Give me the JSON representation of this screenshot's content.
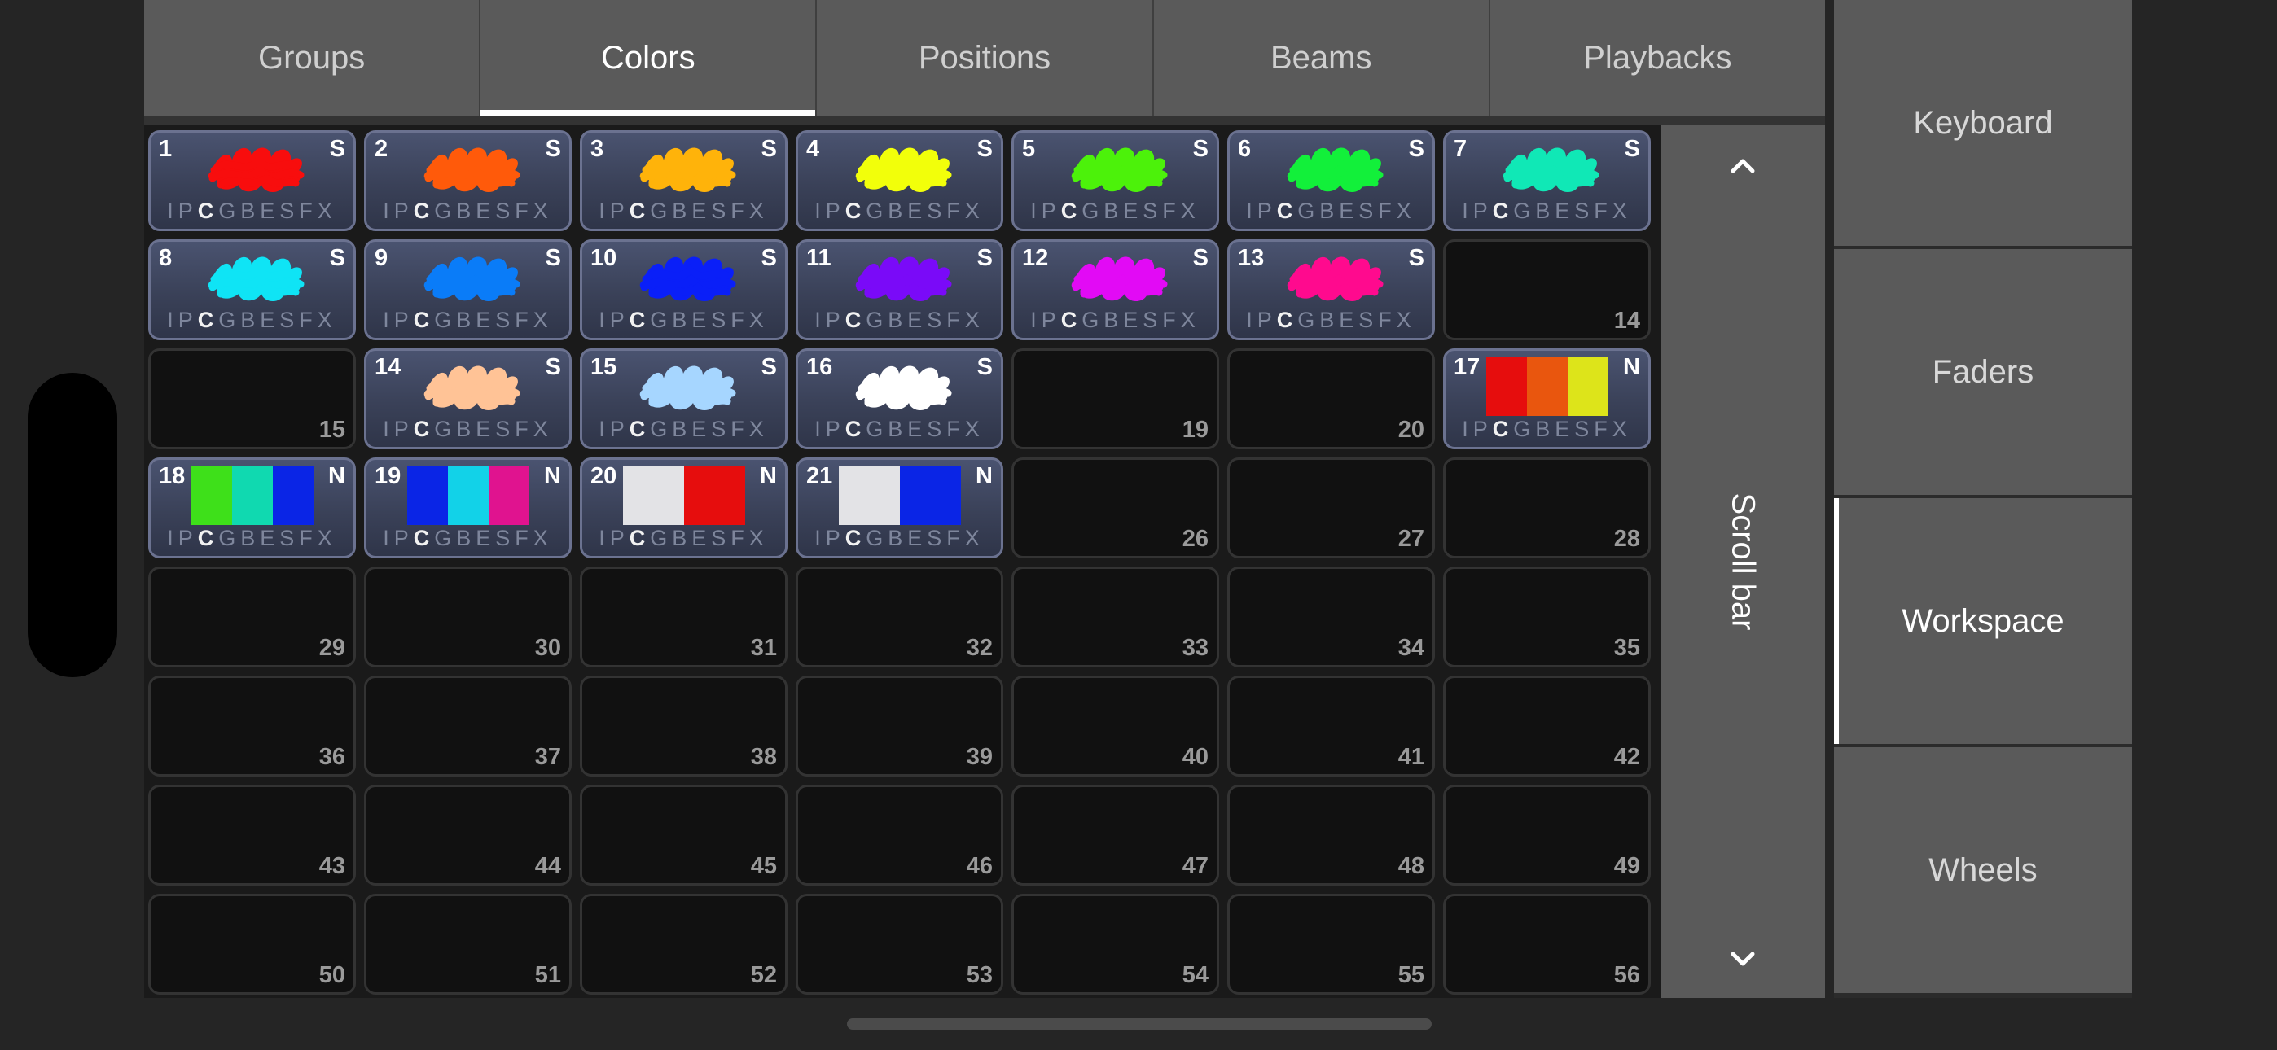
{
  "tabs": [
    {
      "label": "Groups",
      "active": false
    },
    {
      "label": "Colors",
      "active": true
    },
    {
      "label": "Positions",
      "active": false
    },
    {
      "label": "Beams",
      "active": false
    },
    {
      "label": "Playbacks",
      "active": false
    }
  ],
  "scrollbar": {
    "label": "Scroll bar",
    "up_icon": "chevron-up-icon",
    "down_icon": "chevron-down-icon"
  },
  "right_menu": [
    {
      "label": "Keyboard",
      "active": false
    },
    {
      "label": "Faders",
      "active": false
    },
    {
      "label": "Workspace",
      "active": true
    },
    {
      "label": "Wheels",
      "active": false
    }
  ],
  "attribute_letters": [
    "I",
    "P",
    "C",
    "G",
    "B",
    "E",
    "S",
    "FX"
  ],
  "attribute_highlight": "C",
  "cells": [
    {
      "kind": "palette",
      "num": "1",
      "type": "S",
      "color": "#f80d0d"
    },
    {
      "kind": "palette",
      "num": "2",
      "type": "S",
      "color": "#ff5a0a"
    },
    {
      "kind": "palette",
      "num": "3",
      "type": "S",
      "color": "#ffb30a"
    },
    {
      "kind": "palette",
      "num": "4",
      "type": "S",
      "color": "#f2ff0a"
    },
    {
      "kind": "palette",
      "num": "5",
      "type": "S",
      "color": "#4cf20a"
    },
    {
      "kind": "palette",
      "num": "6",
      "type": "S",
      "color": "#12f03a"
    },
    {
      "kind": "palette",
      "num": "7",
      "type": "S",
      "color": "#10e8b6"
    },
    {
      "kind": "palette",
      "num": "8",
      "type": "S",
      "color": "#0fe4f5"
    },
    {
      "kind": "palette",
      "num": "9",
      "type": "S",
      "color": "#0a7cf8"
    },
    {
      "kind": "palette",
      "num": "10",
      "type": "S",
      "color": "#0a1ff8"
    },
    {
      "kind": "palette",
      "num": "11",
      "type": "S",
      "color": "#7a0af8"
    },
    {
      "kind": "palette",
      "num": "12",
      "type": "S",
      "color": "#e20af5"
    },
    {
      "kind": "palette",
      "num": "13",
      "type": "S",
      "color": "#ff0a8e"
    },
    {
      "kind": "empty",
      "corner": "14"
    },
    {
      "kind": "empty",
      "corner": "15"
    },
    {
      "kind": "palette",
      "num": "14",
      "type": "S",
      "color": "#ffc396"
    },
    {
      "kind": "palette",
      "num": "15",
      "type": "S",
      "color": "#a6d6ff"
    },
    {
      "kind": "palette",
      "num": "16",
      "type": "S",
      "color": "#ffffff"
    },
    {
      "kind": "empty",
      "corner": "19"
    },
    {
      "kind": "empty",
      "corner": "20"
    },
    {
      "kind": "blocks",
      "num": "17",
      "type": "N",
      "colors": [
        "#e60d0d",
        "#e9560e",
        "#dde41a"
      ]
    },
    {
      "kind": "blocks",
      "num": "18",
      "type": "N",
      "colors": [
        "#3ee01a",
        "#10d9b0",
        "#0a25e6"
      ]
    },
    {
      "kind": "blocks",
      "num": "19",
      "type": "N",
      "colors": [
        "#0a25e6",
        "#12d2e8",
        "#e0138f"
      ]
    },
    {
      "kind": "blocks",
      "num": "20",
      "type": "N",
      "colors": [
        "#e3e3e6",
        "#e60d0d"
      ]
    },
    {
      "kind": "blocks",
      "num": "21",
      "type": "N",
      "colors": [
        "#e3e3e6",
        "#0a25e6"
      ]
    },
    {
      "kind": "empty",
      "corner": "26"
    },
    {
      "kind": "empty",
      "corner": "27"
    },
    {
      "kind": "empty",
      "corner": "28"
    },
    {
      "kind": "empty",
      "corner": "29"
    },
    {
      "kind": "empty",
      "corner": "30"
    },
    {
      "kind": "empty",
      "corner": "31"
    },
    {
      "kind": "empty",
      "corner": "32"
    },
    {
      "kind": "empty",
      "corner": "33"
    },
    {
      "kind": "empty",
      "corner": "34"
    },
    {
      "kind": "empty",
      "corner": "35"
    },
    {
      "kind": "empty",
      "corner": "36"
    },
    {
      "kind": "empty",
      "corner": "37"
    },
    {
      "kind": "empty",
      "corner": "38"
    },
    {
      "kind": "empty",
      "corner": "39"
    },
    {
      "kind": "empty",
      "corner": "40"
    },
    {
      "kind": "empty",
      "corner": "41"
    },
    {
      "kind": "empty",
      "corner": "42"
    },
    {
      "kind": "empty",
      "corner": "43"
    },
    {
      "kind": "empty",
      "corner": "44"
    },
    {
      "kind": "empty",
      "corner": "45"
    },
    {
      "kind": "empty",
      "corner": "46"
    },
    {
      "kind": "empty",
      "corner": "47"
    },
    {
      "kind": "empty",
      "corner": "48"
    },
    {
      "kind": "empty",
      "corner": "49"
    },
    {
      "kind": "empty",
      "corner": "50"
    },
    {
      "kind": "empty",
      "corner": "51"
    },
    {
      "kind": "empty",
      "corner": "52"
    },
    {
      "kind": "empty",
      "corner": "53"
    },
    {
      "kind": "empty",
      "corner": "54"
    },
    {
      "kind": "empty",
      "corner": "55"
    },
    {
      "kind": "empty",
      "corner": "56"
    }
  ]
}
